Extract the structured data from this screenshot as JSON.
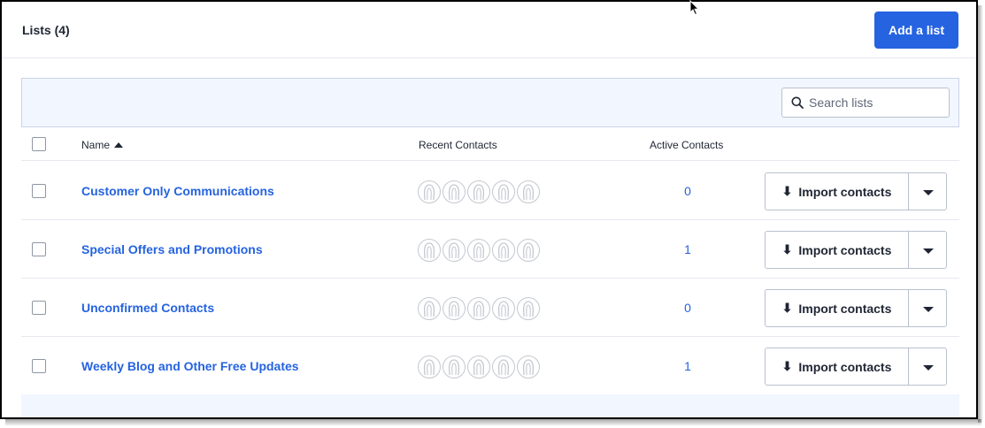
{
  "header": {
    "title": "Lists (4)",
    "add_button": "Add a list"
  },
  "search": {
    "placeholder": "Search lists",
    "icon": "search-icon"
  },
  "table": {
    "columns": {
      "name": "Name",
      "recent": "Recent Contacts",
      "active": "Active Contacts"
    },
    "sort": {
      "column": "Name",
      "direction": "ascending"
    },
    "rows": [
      {
        "name": "Customer Only Communications",
        "active": "0",
        "action": "Import contacts"
      },
      {
        "name": "Special Offers and Promotions",
        "active": "1",
        "action": "Import contacts"
      },
      {
        "name": "Unconfirmed Contacts",
        "active": "0",
        "action": "Import contacts"
      },
      {
        "name": "Weekly Blog and Other Free Updates",
        "active": "1",
        "action": "Import contacts"
      }
    ]
  },
  "colors": {
    "accent": "#2563e0",
    "toolbar_bg": "#f2f6fe"
  }
}
